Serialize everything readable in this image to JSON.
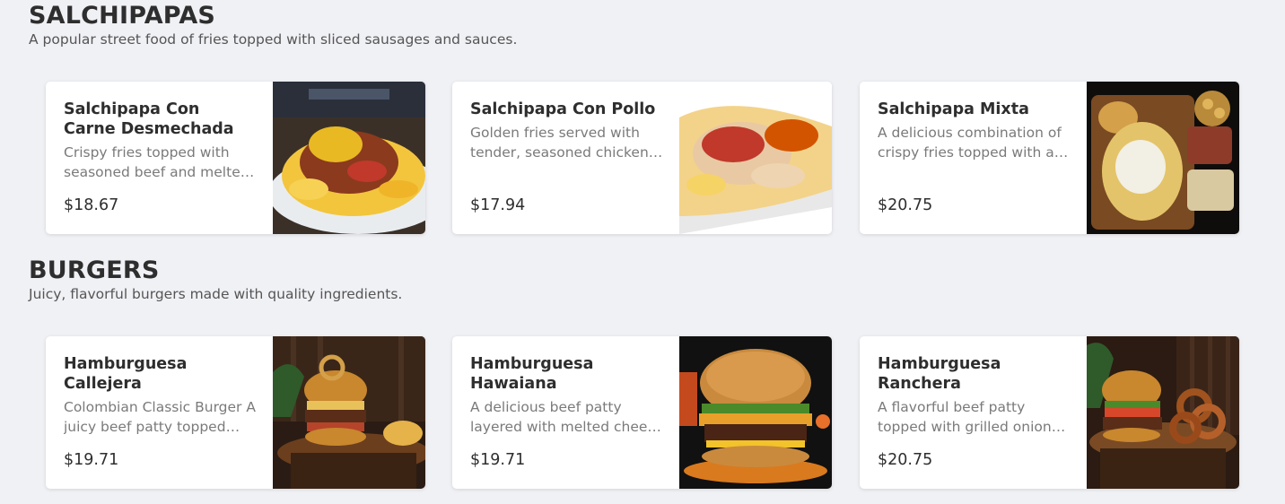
{
  "sections": [
    {
      "title": "SALCHIPAPAS",
      "description": "A popular street food of fries topped with sliced sausages and sauces.",
      "items": [
        {
          "name": "Salchipapa Con Carne Desmechada",
          "description": "Crispy fries topped with seasoned beef and melted cheese",
          "price": "$18.67",
          "image": "salchipapa-carne-photo"
        },
        {
          "name": "Salchipapa Con Pollo",
          "description": "Golden fries served with tender, seasoned chicken and sauces",
          "price": "$17.94",
          "image": "salchipapa-pollo-photo"
        },
        {
          "name": "Salchipapa Mixta",
          "description": "A delicious combination of crispy fries topped with a mix of meats",
          "price": "$20.75",
          "image": "salchipapa-mixta-photo"
        }
      ]
    },
    {
      "title": "BURGERS",
      "description": "Juicy, flavorful burgers made with quality ingredients.",
      "items": [
        {
          "name": "Hamburguesa Callejera",
          "description": "Colombian Classic Burger A juicy beef patty topped with bacon",
          "price": "$19.71",
          "image": "hamburguesa-callejera-photo"
        },
        {
          "name": "Hamburguesa Hawaiana",
          "description": "A delicious beef patty layered with melted cheese and pineapple",
          "price": "$19.71",
          "image": "hamburguesa-hawaiana-photo"
        },
        {
          "name": "Hamburguesa Ranchera",
          "description": "A flavorful beef patty topped with grilled onions and sauce",
          "price": "$20.75",
          "image": "hamburguesa-ranchera-photo"
        }
      ]
    }
  ]
}
